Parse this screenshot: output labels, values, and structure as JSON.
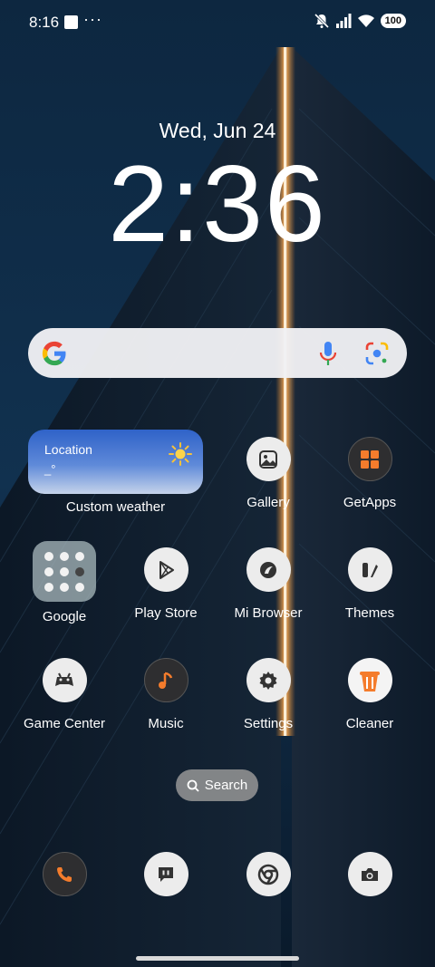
{
  "status_bar": {
    "time": "8:16",
    "more": "···",
    "battery": "100",
    "icons": [
      "notification-square-icon",
      "more-dots-icon",
      "mute-icon",
      "signal-icon",
      "wifi-icon",
      "battery-icon"
    ]
  },
  "lockclock": {
    "date": "Wed, Jun 24",
    "time": "2:36"
  },
  "search_bar": {
    "icons": [
      "google-g-icon",
      "mic-icon",
      "google-lens-icon"
    ]
  },
  "weather": {
    "location": "Location",
    "temp": "_°",
    "caption": "Custom weather",
    "icon": "sun-icon"
  },
  "apps": {
    "gallery": "Gallery",
    "getapps": "GetApps",
    "google": "Google",
    "play_store": "Play Store",
    "mi_browser": "Mi Browser",
    "themes": "Themes",
    "game_center": "Game Center",
    "music": "Music",
    "settings": "Settings",
    "cleaner": "Cleaner"
  },
  "search_pill": {
    "label": "Search"
  },
  "dock": {
    "icons": [
      "phone-icon",
      "messages-icon",
      "chrome-icon",
      "camera-icon"
    ]
  },
  "colors": {
    "accent_orange": "#F47C2C",
    "search_bg": "#F0F0F4",
    "weather_blue": "#2F62C8"
  }
}
